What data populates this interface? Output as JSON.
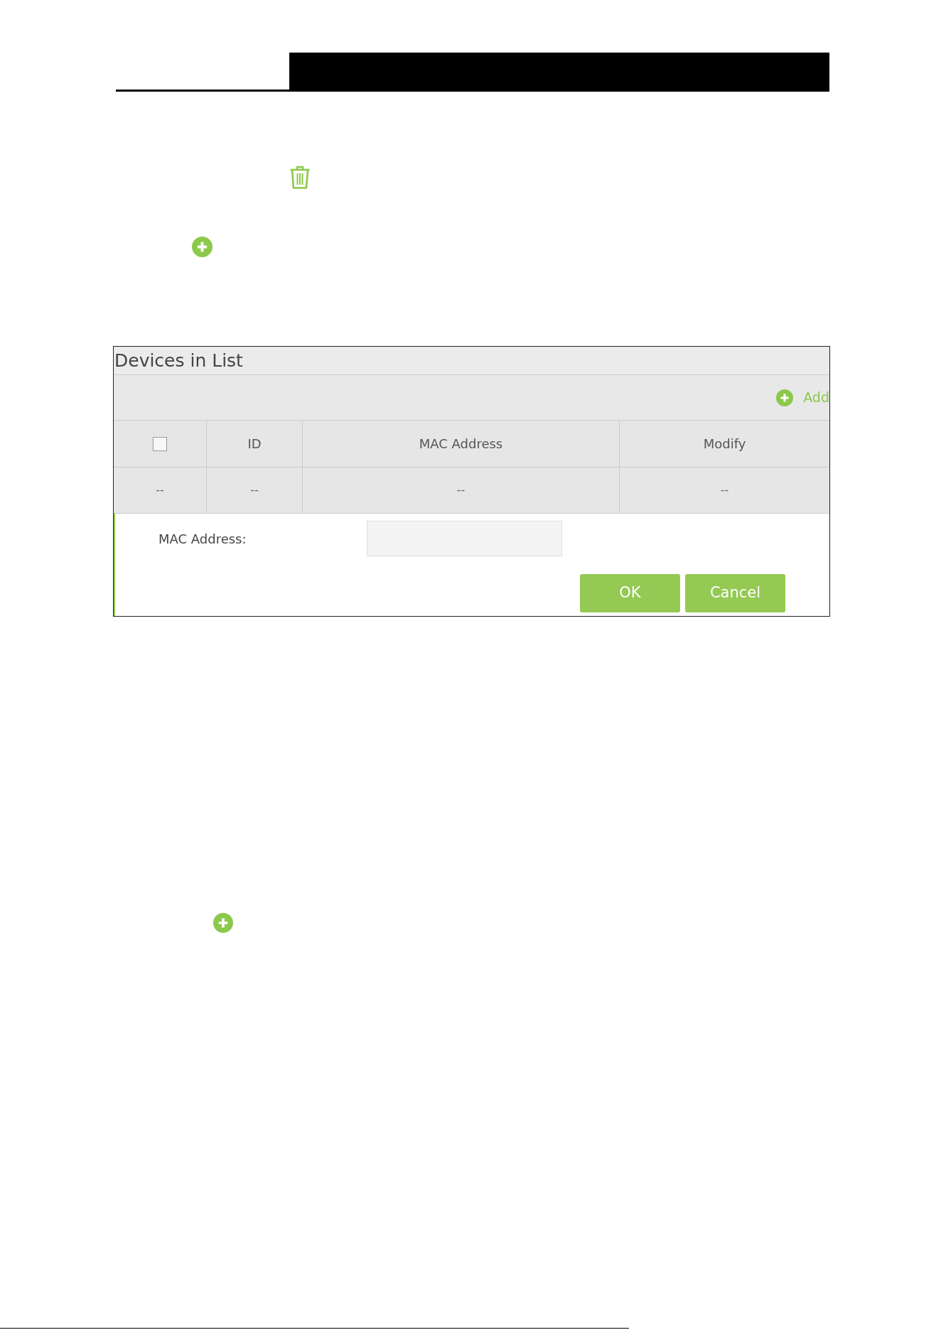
{
  "panel": {
    "title": "Devices in List",
    "add_link": "Add",
    "table": {
      "columns": [
        {
          "kind": "checkbox",
          "checked": false
        },
        {
          "kind": "text",
          "label": "ID"
        },
        {
          "kind": "text",
          "label": "MAC Address"
        },
        {
          "kind": "text",
          "label": "Modify"
        }
      ],
      "rows": [
        [
          "--",
          "--",
          "--",
          "--"
        ]
      ]
    },
    "form": {
      "fields": [
        {
          "label": "MAC Address:"
        }
      ],
      "buttons": [
        "OK",
        "Cancel"
      ]
    }
  }
}
